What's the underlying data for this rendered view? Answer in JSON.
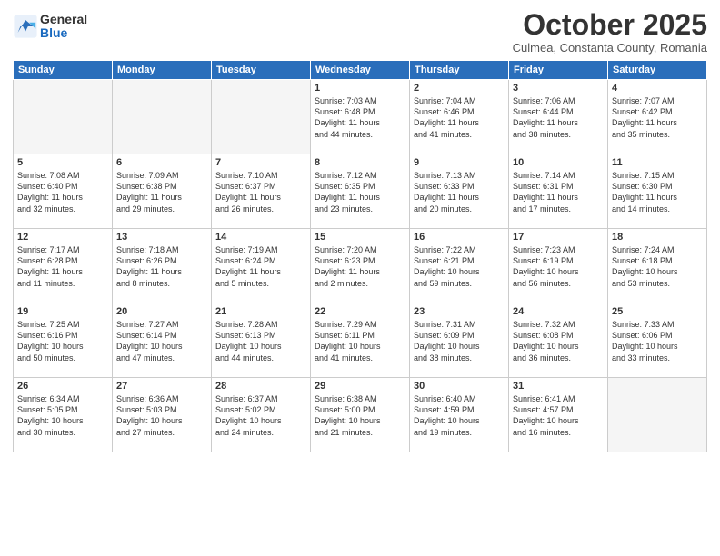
{
  "header": {
    "logo_general": "General",
    "logo_blue": "Blue",
    "month_title": "October 2025",
    "location": "Culmea, Constanta County, Romania"
  },
  "days_of_week": [
    "Sunday",
    "Monday",
    "Tuesday",
    "Wednesday",
    "Thursday",
    "Friday",
    "Saturday"
  ],
  "weeks": [
    [
      {
        "day": "",
        "info": ""
      },
      {
        "day": "",
        "info": ""
      },
      {
        "day": "",
        "info": ""
      },
      {
        "day": "1",
        "info": "Sunrise: 7:03 AM\nSunset: 6:48 PM\nDaylight: 11 hours\nand 44 minutes."
      },
      {
        "day": "2",
        "info": "Sunrise: 7:04 AM\nSunset: 6:46 PM\nDaylight: 11 hours\nand 41 minutes."
      },
      {
        "day": "3",
        "info": "Sunrise: 7:06 AM\nSunset: 6:44 PM\nDaylight: 11 hours\nand 38 minutes."
      },
      {
        "day": "4",
        "info": "Sunrise: 7:07 AM\nSunset: 6:42 PM\nDaylight: 11 hours\nand 35 minutes."
      }
    ],
    [
      {
        "day": "5",
        "info": "Sunrise: 7:08 AM\nSunset: 6:40 PM\nDaylight: 11 hours\nand 32 minutes."
      },
      {
        "day": "6",
        "info": "Sunrise: 7:09 AM\nSunset: 6:38 PM\nDaylight: 11 hours\nand 29 minutes."
      },
      {
        "day": "7",
        "info": "Sunrise: 7:10 AM\nSunset: 6:37 PM\nDaylight: 11 hours\nand 26 minutes."
      },
      {
        "day": "8",
        "info": "Sunrise: 7:12 AM\nSunset: 6:35 PM\nDaylight: 11 hours\nand 23 minutes."
      },
      {
        "day": "9",
        "info": "Sunrise: 7:13 AM\nSunset: 6:33 PM\nDaylight: 11 hours\nand 20 minutes."
      },
      {
        "day": "10",
        "info": "Sunrise: 7:14 AM\nSunset: 6:31 PM\nDaylight: 11 hours\nand 17 minutes."
      },
      {
        "day": "11",
        "info": "Sunrise: 7:15 AM\nSunset: 6:30 PM\nDaylight: 11 hours\nand 14 minutes."
      }
    ],
    [
      {
        "day": "12",
        "info": "Sunrise: 7:17 AM\nSunset: 6:28 PM\nDaylight: 11 hours\nand 11 minutes."
      },
      {
        "day": "13",
        "info": "Sunrise: 7:18 AM\nSunset: 6:26 PM\nDaylight: 11 hours\nand 8 minutes."
      },
      {
        "day": "14",
        "info": "Sunrise: 7:19 AM\nSunset: 6:24 PM\nDaylight: 11 hours\nand 5 minutes."
      },
      {
        "day": "15",
        "info": "Sunrise: 7:20 AM\nSunset: 6:23 PM\nDaylight: 11 hours\nand 2 minutes."
      },
      {
        "day": "16",
        "info": "Sunrise: 7:22 AM\nSunset: 6:21 PM\nDaylight: 10 hours\nand 59 minutes."
      },
      {
        "day": "17",
        "info": "Sunrise: 7:23 AM\nSunset: 6:19 PM\nDaylight: 10 hours\nand 56 minutes."
      },
      {
        "day": "18",
        "info": "Sunrise: 7:24 AM\nSunset: 6:18 PM\nDaylight: 10 hours\nand 53 minutes."
      }
    ],
    [
      {
        "day": "19",
        "info": "Sunrise: 7:25 AM\nSunset: 6:16 PM\nDaylight: 10 hours\nand 50 minutes."
      },
      {
        "day": "20",
        "info": "Sunrise: 7:27 AM\nSunset: 6:14 PM\nDaylight: 10 hours\nand 47 minutes."
      },
      {
        "day": "21",
        "info": "Sunrise: 7:28 AM\nSunset: 6:13 PM\nDaylight: 10 hours\nand 44 minutes."
      },
      {
        "day": "22",
        "info": "Sunrise: 7:29 AM\nSunset: 6:11 PM\nDaylight: 10 hours\nand 41 minutes."
      },
      {
        "day": "23",
        "info": "Sunrise: 7:31 AM\nSunset: 6:09 PM\nDaylight: 10 hours\nand 38 minutes."
      },
      {
        "day": "24",
        "info": "Sunrise: 7:32 AM\nSunset: 6:08 PM\nDaylight: 10 hours\nand 36 minutes."
      },
      {
        "day": "25",
        "info": "Sunrise: 7:33 AM\nSunset: 6:06 PM\nDaylight: 10 hours\nand 33 minutes."
      }
    ],
    [
      {
        "day": "26",
        "info": "Sunrise: 6:34 AM\nSunset: 5:05 PM\nDaylight: 10 hours\nand 30 minutes."
      },
      {
        "day": "27",
        "info": "Sunrise: 6:36 AM\nSunset: 5:03 PM\nDaylight: 10 hours\nand 27 minutes."
      },
      {
        "day": "28",
        "info": "Sunrise: 6:37 AM\nSunset: 5:02 PM\nDaylight: 10 hours\nand 24 minutes."
      },
      {
        "day": "29",
        "info": "Sunrise: 6:38 AM\nSunset: 5:00 PM\nDaylight: 10 hours\nand 21 minutes."
      },
      {
        "day": "30",
        "info": "Sunrise: 6:40 AM\nSunset: 4:59 PM\nDaylight: 10 hours\nand 19 minutes."
      },
      {
        "day": "31",
        "info": "Sunrise: 6:41 AM\nSunset: 4:57 PM\nDaylight: 10 hours\nand 16 minutes."
      },
      {
        "day": "",
        "info": ""
      }
    ]
  ]
}
